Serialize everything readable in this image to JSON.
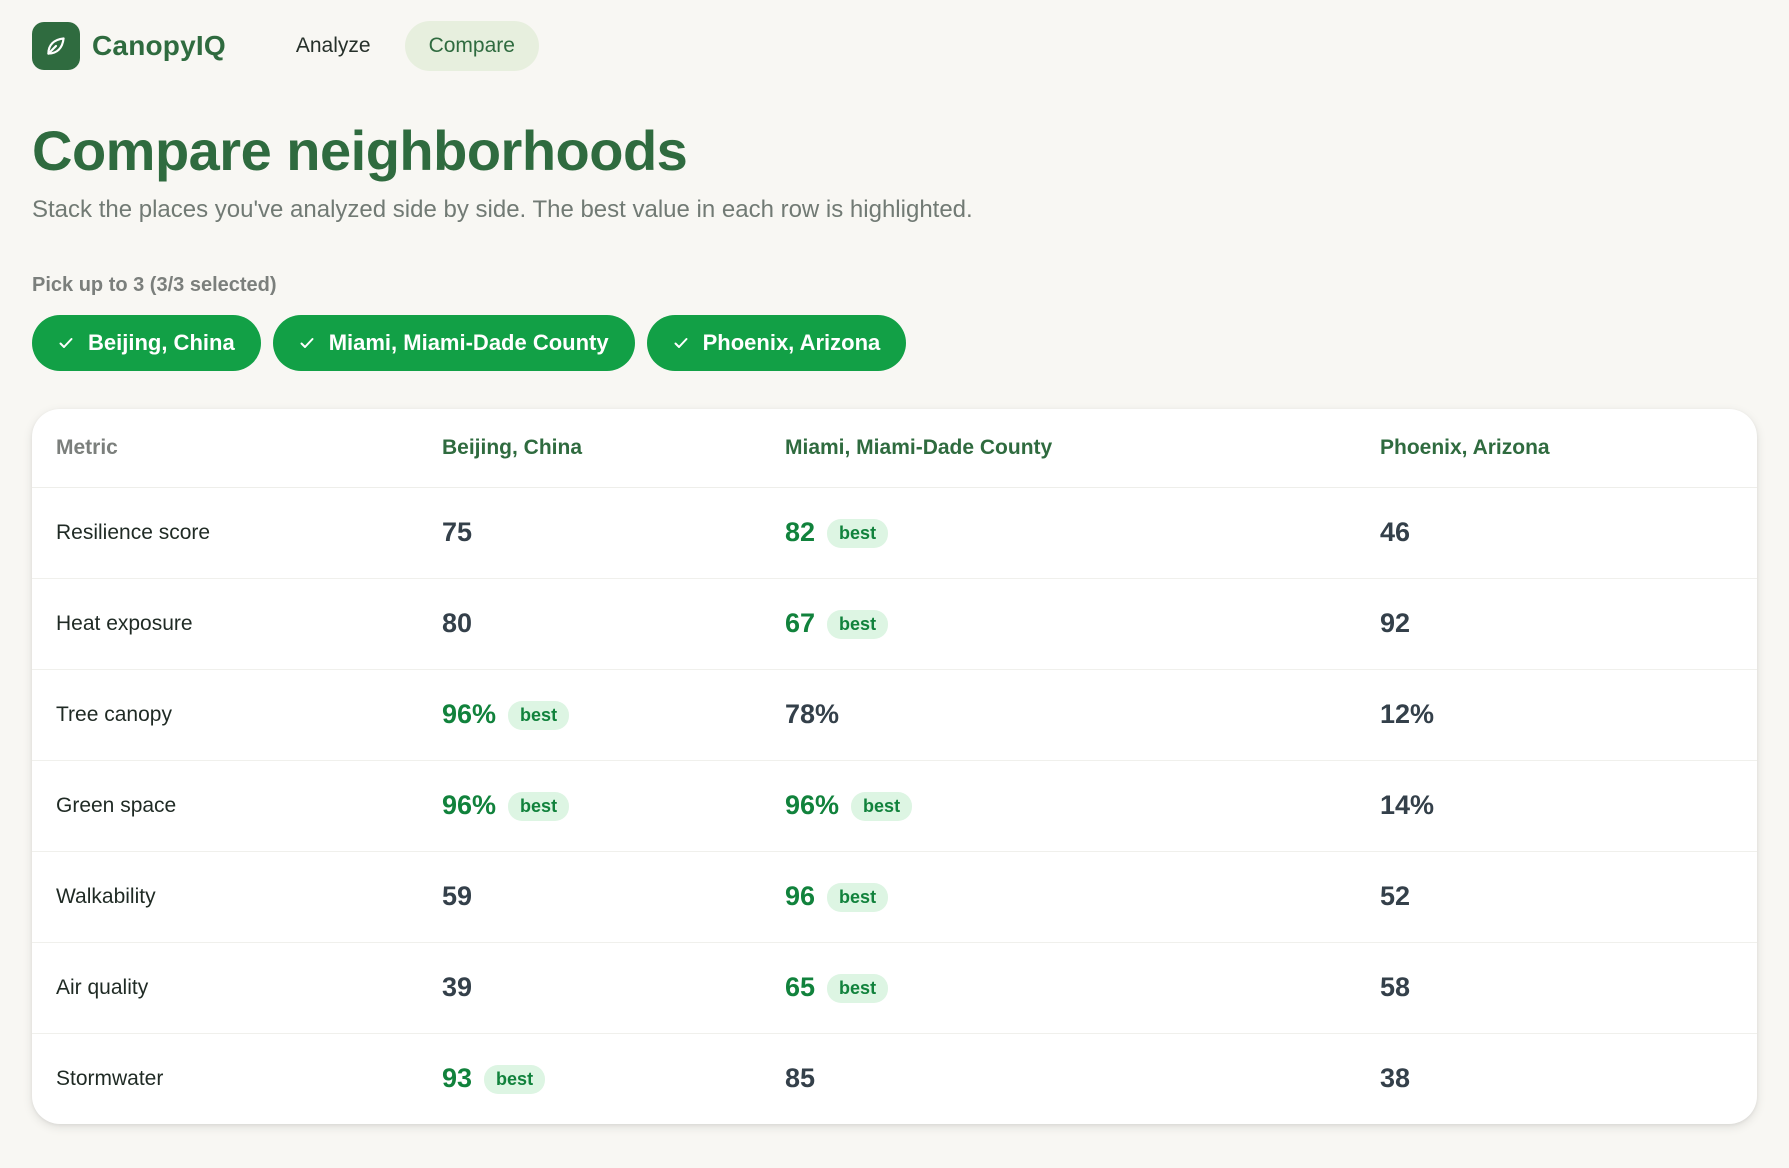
{
  "brand": {
    "name": "CanopyIQ",
    "logo_icon": "leaf-icon",
    "color": "#2f6b3f"
  },
  "nav": {
    "items": [
      {
        "label": "Analyze",
        "active": false
      },
      {
        "label": "Compare",
        "active": true
      }
    ]
  },
  "header": {
    "title": "Compare neighborhoods",
    "subtitle": "Stack the places you've analyzed side by side. The best value in each row is highlighted."
  },
  "picker": {
    "label": "Pick up to 3 (3/3 selected)",
    "chips": [
      {
        "label": "Beijing, China",
        "selected": true
      },
      {
        "label": "Miami, Miami-Dade County",
        "selected": true
      },
      {
        "label": "Phoenix, Arizona",
        "selected": true
      }
    ],
    "chip_color": "#12a046"
  },
  "table": {
    "metric_header": "Metric",
    "columns": [
      "Beijing, China",
      "Miami, Miami-Dade County",
      "Phoenix, Arizona"
    ],
    "best_label": "best",
    "rows": [
      {
        "metric": "Resilience score",
        "values": [
          "75",
          "82",
          "46"
        ],
        "best": [
          false,
          true,
          false
        ]
      },
      {
        "metric": "Heat exposure",
        "values": [
          "80",
          "67",
          "92"
        ],
        "best": [
          false,
          true,
          false
        ]
      },
      {
        "metric": "Tree canopy",
        "values": [
          "96%",
          "78%",
          "12%"
        ],
        "best": [
          true,
          false,
          false
        ]
      },
      {
        "metric": "Green space",
        "values": [
          "96%",
          "96%",
          "14%"
        ],
        "best": [
          true,
          true,
          false
        ]
      },
      {
        "metric": "Walkability",
        "values": [
          "59",
          "96",
          "52"
        ],
        "best": [
          false,
          true,
          false
        ]
      },
      {
        "metric": "Air quality",
        "values": [
          "39",
          "65",
          "58"
        ],
        "best": [
          false,
          true,
          false
        ]
      },
      {
        "metric": "Stormwater",
        "values": [
          "93",
          "85",
          "38"
        ],
        "best": [
          true,
          false,
          false
        ]
      }
    ]
  },
  "colors": {
    "background": "#f8f7f3",
    "best_text": "#11823c",
    "best_badge_bg": "#ddf5e3"
  }
}
